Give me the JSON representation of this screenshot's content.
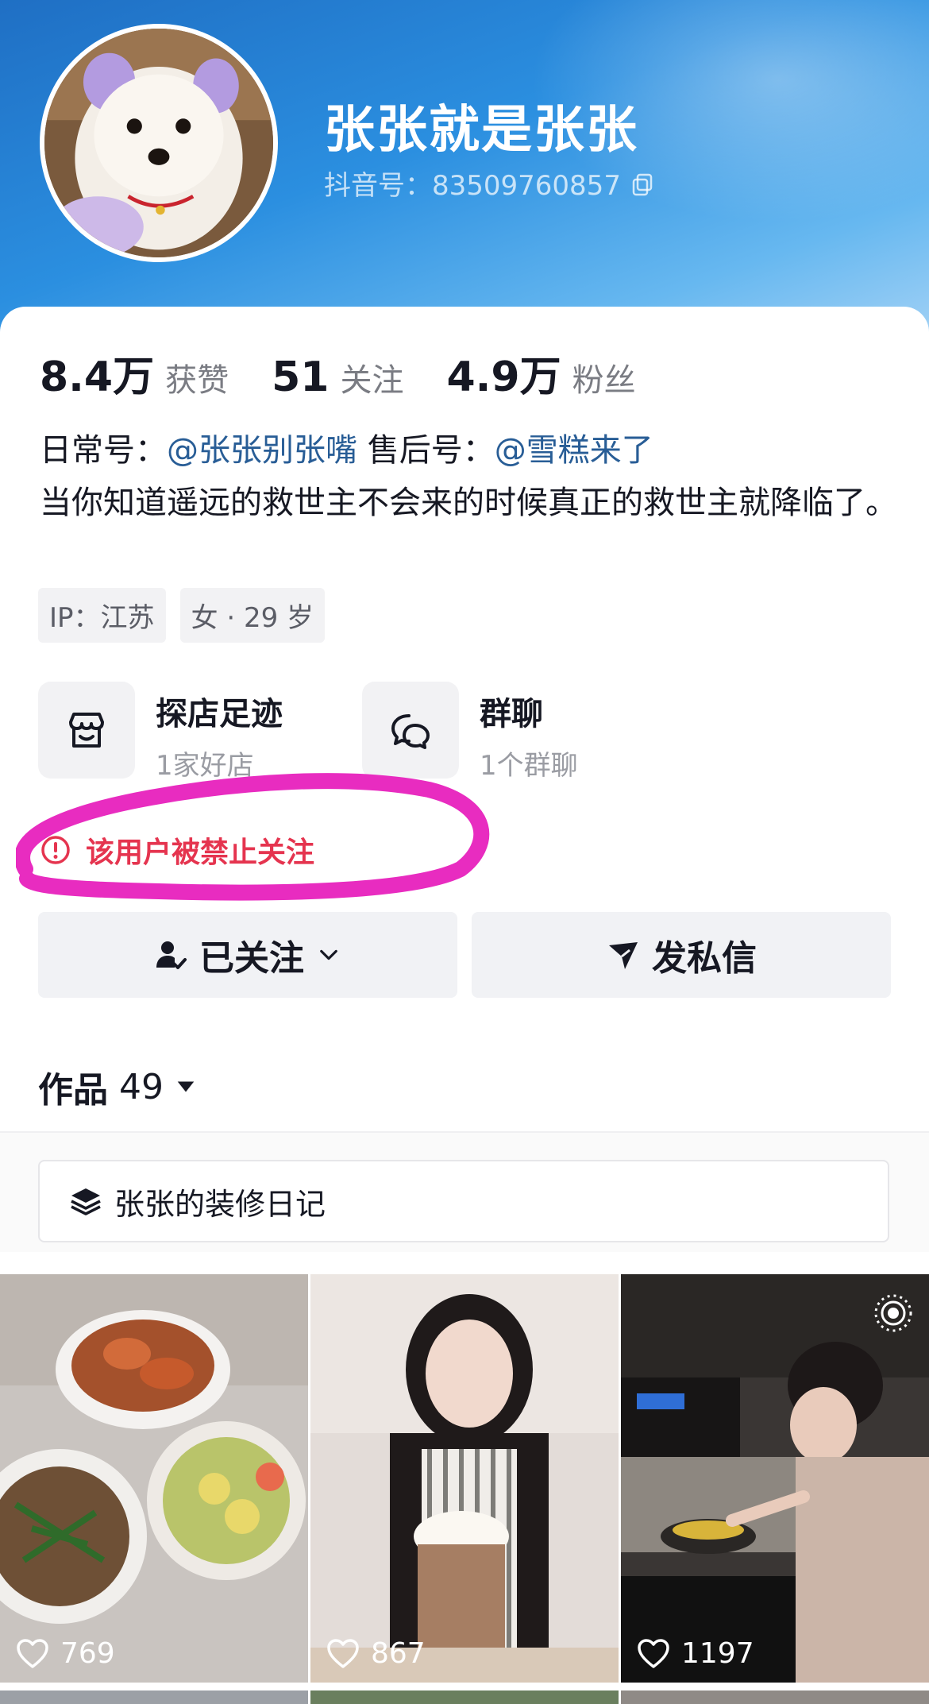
{
  "profile": {
    "name": "张张就是张张",
    "douyin_id": "抖音号：83509760857"
  },
  "stats": [
    {
      "value": "8.4万",
      "label": "获赞"
    },
    {
      "value": "51",
      "label": "关注"
    },
    {
      "value": "4.9万",
      "label": "粉丝"
    }
  ],
  "bio": {
    "daily_prefix": "日常号：",
    "daily_account": "@张张别张嘴",
    "aftersale_prefix": "售后号：",
    "aftersale_account": "@雪糕来了",
    "text": "当你知道遥远的救世主不会来的时候真正的救世主就降临了。"
  },
  "tags": [
    "IP：江苏",
    "女 · 29 岁"
  ],
  "features": [
    {
      "title": "探店足迹",
      "subtitle": "1家好店",
      "icon": "shop-icon"
    },
    {
      "title": "群聊",
      "subtitle": "1个群聊",
      "icon": "chat-bubbles-icon"
    }
  ],
  "warning": "该用户被禁止关注",
  "actions": {
    "follow_label": "已关注",
    "message_label": "发私信"
  },
  "works": {
    "label": "作品",
    "count": "49"
  },
  "collection": "张张的装修日记",
  "videos": [
    {
      "likes": "769",
      "scene": "food dishes"
    },
    {
      "likes": "867",
      "scene": "woman with drink"
    },
    {
      "likes": "1197",
      "scene": "woman cooking"
    }
  ],
  "colors": {
    "accent_red": "#e5344f",
    "link_blue": "#285d96",
    "highlight_marker": "#e82cc0"
  }
}
